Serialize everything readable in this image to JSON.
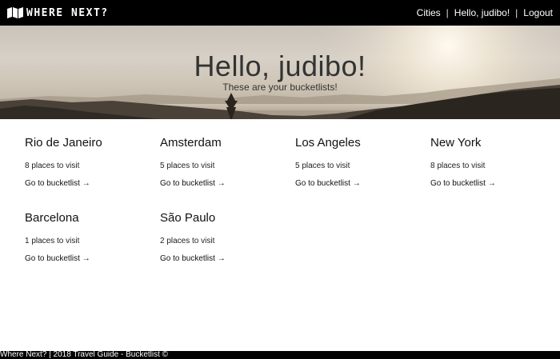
{
  "nav": {
    "brand": "WHERE NEXT?",
    "links": [
      "Cities",
      "Hello, judibo!",
      "Logout"
    ],
    "separator": "|",
    "logo_icon": "map-icon"
  },
  "hero": {
    "title": "Hello, judibo!",
    "subtitle": "These are your bucketlists!"
  },
  "bucketlists": [
    {
      "city": "Rio de Janeiro",
      "count": "8 places to visit",
      "link": "Go to bucketlist →"
    },
    {
      "city": "Amsterdam",
      "count": "5 places to visit",
      "link": "Go to bucketlist →"
    },
    {
      "city": "Los Angeles",
      "count": "5 places to visit",
      "link": "Go to bucketlist →"
    },
    {
      "city": "New York",
      "count": "8 places to visit",
      "link": "Go to bucketlist →"
    },
    {
      "city": "Barcelona",
      "count": "1 places to visit",
      "link": "Go to bucketlist →"
    },
    {
      "city": "São Paulo",
      "count": "2 places to visit",
      "link": "Go to bucketlist →"
    }
  ],
  "footer": {
    "text": "Where Next? | 2018 Travel Guide - Bucketlist ©"
  }
}
